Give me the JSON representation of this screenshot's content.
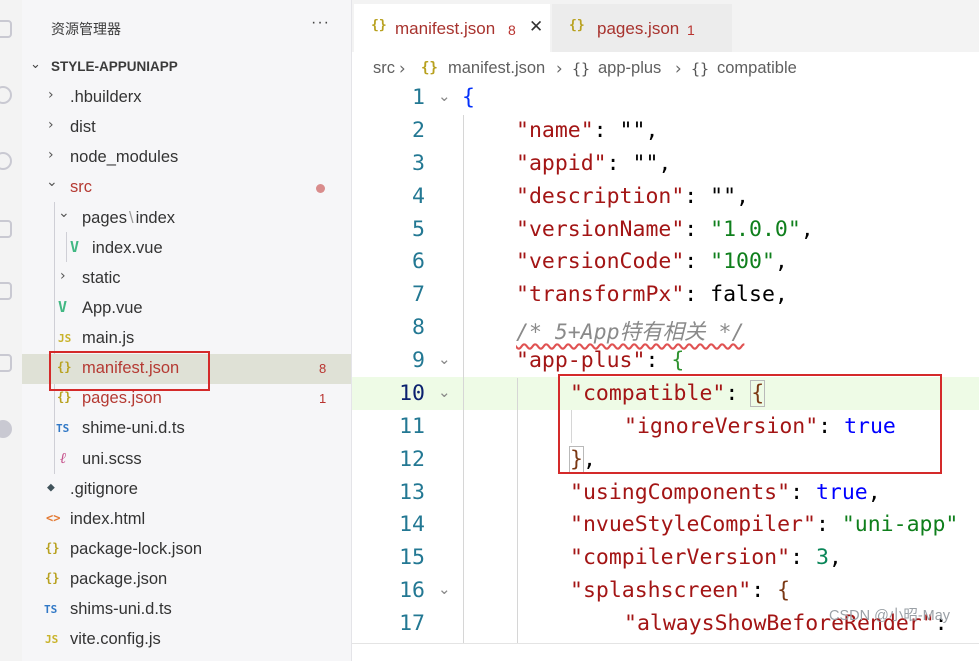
{
  "explorer": {
    "title": "资源管理器",
    "more": "···",
    "project": "STYLE-APPUNIAPP",
    "items": [
      {
        "label": ".hbuilderx",
        "icon": "›"
      },
      {
        "label": "dist",
        "icon": "›"
      },
      {
        "label": "node_modules",
        "icon": "›"
      },
      {
        "label": "src",
        "icon": "⌄"
      },
      {
        "label": "pages",
        "sep": "\\",
        "label2": "index",
        "icon": "⌄"
      },
      {
        "label": "index.vue",
        "icon": "V"
      },
      {
        "label": "static",
        "icon": "›"
      },
      {
        "label": "App.vue",
        "icon": "V"
      },
      {
        "label": "main.js",
        "icon": "JS"
      },
      {
        "label": "manifest.json",
        "icon": "{}",
        "count": "8"
      },
      {
        "label": "pages.json",
        "icon": "{}",
        "count": "1"
      },
      {
        "label": "shime-uni.d.ts",
        "icon": "TS"
      },
      {
        "label": "uni.scss",
        "icon": "ℓ"
      },
      {
        "label": ".gitignore",
        "icon": "◆"
      },
      {
        "label": "index.html",
        "icon": "<>"
      },
      {
        "label": "package-lock.json",
        "icon": "{}"
      },
      {
        "label": "package.json",
        "icon": "{}"
      },
      {
        "label": "shims-uni.d.ts",
        "icon": "TS"
      },
      {
        "label": "vite.config.js",
        "icon": "JS"
      }
    ]
  },
  "tabs": [
    {
      "icon": "{}",
      "name": "manifest.json",
      "count": "8",
      "close": "✕"
    },
    {
      "icon": "{}",
      "name": "pages.json",
      "count": "1"
    }
  ],
  "breadcrumb": {
    "src": "src",
    "sep": "›",
    "file_icon": "{}",
    "file": "manifest.json",
    "obj_icon": "{}",
    "node1": "app-plus",
    "node2": "compatible"
  },
  "code": {
    "line_numbers": [
      "1",
      "2",
      "3",
      "4",
      "5",
      "6",
      "7",
      "8",
      "9",
      "10",
      "11",
      "12",
      "13",
      "14",
      "15",
      "16",
      "17"
    ],
    "fold": "⌄",
    "t": {
      "l1_brace": "{",
      "l2_key": "\"name\"",
      "l2_rest": ": \"\",",
      "l3_key": "\"appid\"",
      "l3_rest": ": \"\",",
      "l4_key": "\"description\"",
      "l4_rest": ": \"\",",
      "l5_key": "\"versionName\"",
      "l5_colon": ": ",
      "l5_val": "\"1.0.0\"",
      "l5_comma": ",",
      "l6_key": "\"versionCode\"",
      "l6_colon": ": ",
      "l6_val": "\"100\"",
      "l6_comma": ",",
      "l7_key": "\"transformPx\"",
      "l7_rest": ": false,",
      "l8_comment": "/* 5+App特有相关 */",
      "l9_key": "\"app-plus\"",
      "l9_colon": ": ",
      "l9_brace": "{",
      "l10_key": "\"compatible\"",
      "l10_colon": ": ",
      "l10_brace": "{",
      "l11_key": "\"ignoreVersion\"",
      "l11_colon": ": ",
      "l11_val": "true",
      "l12_brace": "}",
      "l12_comma": ",",
      "l13_key": "\"usingComponents\"",
      "l13_colon": ": ",
      "l13_val": "true",
      "l13_comma": ",",
      "l14_key": "\"nvueStyleCompiler\"",
      "l14_colon": ": ",
      "l14_val": "\"uni-app\"",
      "l15_key": "\"compilerVersion\"",
      "l15_colon": ": ",
      "l15_val": "3",
      "l15_comma": ",",
      "l16_key": "\"splashscreen\"",
      "l16_colon": ": ",
      "l16_brace": "{",
      "l17_key": "\"alwaysShowBeforeRender\"",
      "l17_colon": ": "
    }
  },
  "watermark": "CSDN @小昭-May",
  "colors": {
    "highlight_box": "#d42a2a",
    "error_text": "#b53a33",
    "json_key": "#a31515",
    "json_string": "#0f7f1c",
    "line_number": "#237893"
  }
}
